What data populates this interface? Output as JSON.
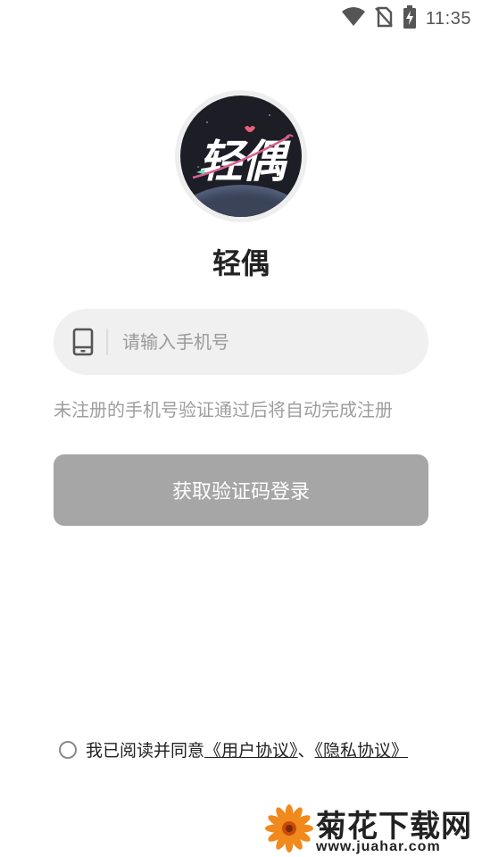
{
  "status_bar": {
    "time": "11:35",
    "icons": [
      "wifi-icon",
      "no-sim-icon",
      "battery-charging-icon"
    ]
  },
  "app": {
    "logo_text": "轻偶",
    "name": "轻偶"
  },
  "login": {
    "phone_placeholder": "请输入手机号",
    "phone_value": "",
    "phone_icon": "phone-icon",
    "hint": "未注册的手机号验证通过后将自动完成注册",
    "button_label": "获取验证码登录",
    "button_color": "#a6a6a6"
  },
  "agreement": {
    "checked": false,
    "prefix": "我已阅读并同意",
    "user_agreement": "《用户协议》",
    "separator": "、",
    "privacy_policy": "《隐私协议》"
  },
  "watermark": {
    "title": "菊花下载网",
    "url": "www.juahar.com",
    "icon": "flower-icon"
  },
  "colors": {
    "background": "#ffffff",
    "input_bg": "#f0f0f0",
    "hint_text": "#9e9e9e"
  }
}
